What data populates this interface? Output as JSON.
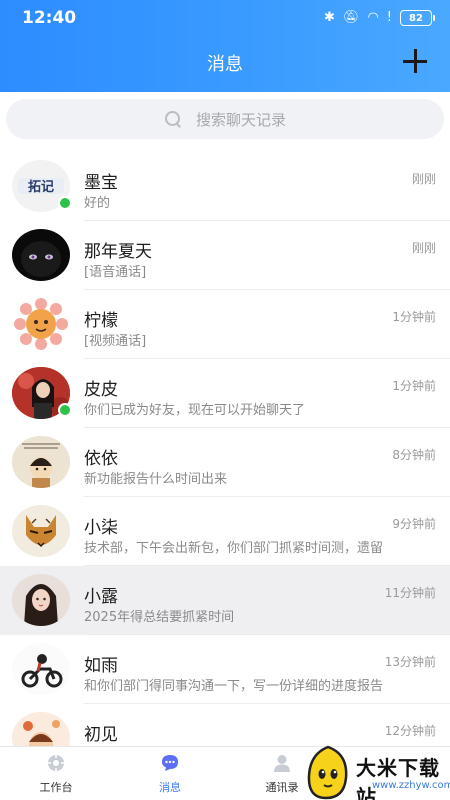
{
  "status_bar": {
    "time": "12:40",
    "battery": "82"
  },
  "header": {
    "title": "消息"
  },
  "search": {
    "placeholder": "搜索聊天记录"
  },
  "conversations": [
    {
      "name": "墨宝",
      "time": "刚刚",
      "preview": "好的",
      "online": true,
      "avatar_text": "拓记"
    },
    {
      "name": "那年夏天",
      "time": "刚刚",
      "preview": "[语音通话]",
      "online": false
    },
    {
      "name": "柠檬",
      "time": "1分钟前",
      "preview": "[视频通话]",
      "online": false
    },
    {
      "name": "皮皮",
      "time": "1分钟前",
      "preview": "你们已成为好友，现在可以开始聊天了",
      "online": true
    },
    {
      "name": "依依",
      "time": "8分钟前",
      "preview": "新功能报告什么时间出来",
      "online": false
    },
    {
      "name": "小柒",
      "time": "9分钟前",
      "preview": "技术部，下午会出新包，你们部门抓紧时间测，遗留",
      "online": false
    },
    {
      "name": "小露",
      "time": "11分钟前",
      "preview": "2025年得总结要抓紧时间",
      "online": false,
      "highlighted": true
    },
    {
      "name": "如雨",
      "time": "13分钟前",
      "preview": "和你们部门得同事沟通一下，写一份详细的进度报告",
      "online": false
    },
    {
      "name": "初见",
      "time": "12分钟前",
      "preview": "",
      "online": false
    }
  ],
  "tabbar": {
    "items": [
      {
        "label": "工作台",
        "icon": "workbench-icon",
        "active": false
      },
      {
        "label": "消息",
        "icon": "chat-icon",
        "active": true
      },
      {
        "label": "通讯录",
        "icon": "contacts-icon",
        "active": false
      }
    ]
  },
  "watermark": {
    "text": "大米下载站",
    "url": "www.zzhyw.com"
  },
  "colors": {
    "header_start": "#2d8cff",
    "accent": "#3d7dfa",
    "online": "#2fc24a"
  }
}
